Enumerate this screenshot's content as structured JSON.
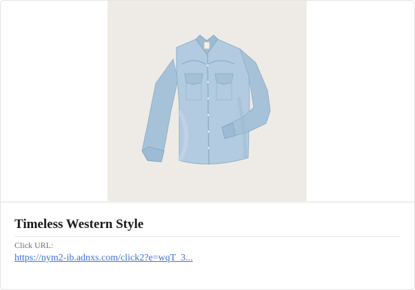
{
  "ad": {
    "title": "Timeless Western Style",
    "click_url_label": "Click URL:",
    "click_url": "https://nym2-ib.adnxs.com/click2?e=wqT_3...",
    "image": {
      "subject": "light-wash denim western shirt",
      "background_color": "#eeebe6",
      "shirt_color": "#a9c4da"
    }
  }
}
